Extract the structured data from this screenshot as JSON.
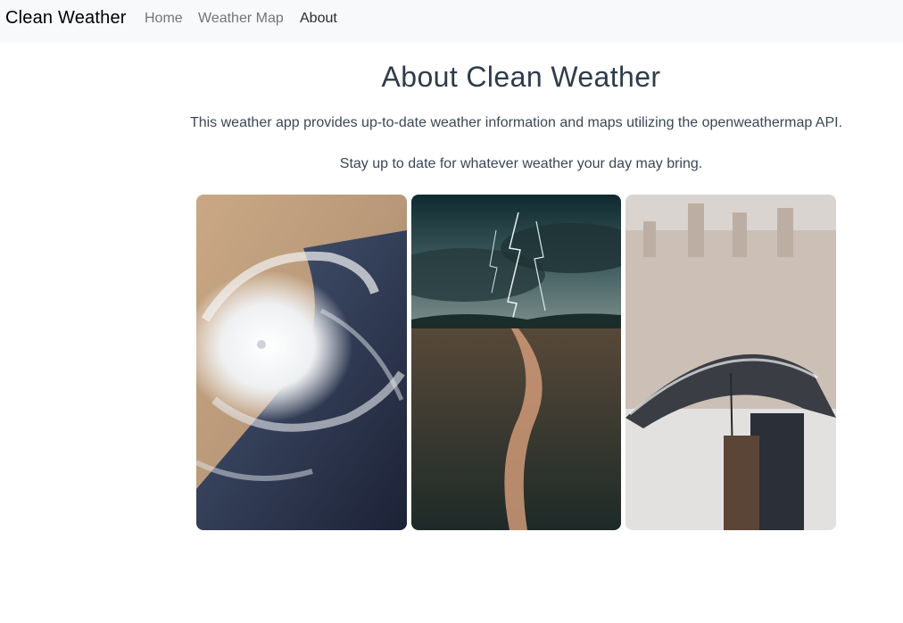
{
  "navbar": {
    "brand": "Clean Weather",
    "links": [
      {
        "label": "Home"
      },
      {
        "label": "Weather Map"
      },
      {
        "label": "About"
      }
    ]
  },
  "main": {
    "title": "About Clean Weather",
    "paragraphs": [
      "This weather app provides up-to-date weather information and maps utilizing the openweathermap API.",
      "Stay up to date for whatever weather your day may bring."
    ],
    "images": [
      {
        "name": "hurricane-satellite-photo"
      },
      {
        "name": "lightning-storm-photo"
      },
      {
        "name": "snow-umbrella-photo"
      }
    ]
  }
}
